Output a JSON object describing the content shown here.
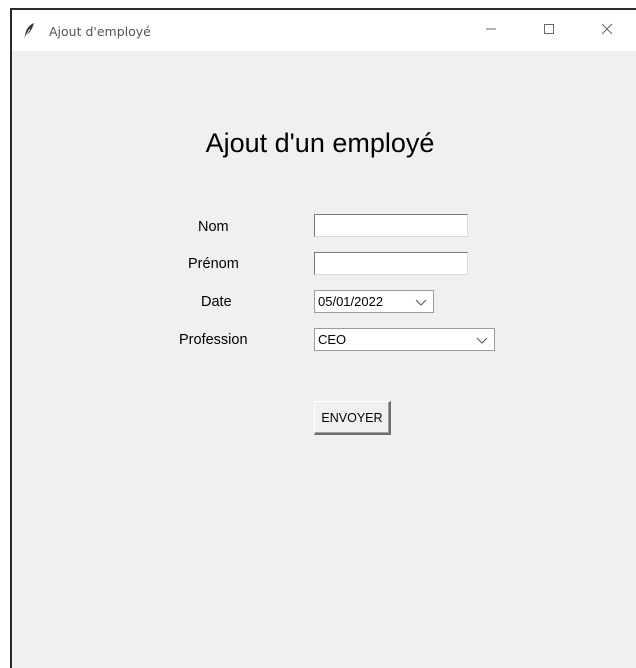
{
  "window": {
    "title": "Ajout d'employé"
  },
  "form": {
    "heading": "Ajout d'un employé",
    "nom_label": "Nom",
    "nom_value": "",
    "prenom_label": "Prénom",
    "prenom_value": "",
    "date_label": "Date",
    "date_value": "05/01/2022",
    "profession_label": "Profession",
    "profession_value": "CEO",
    "submit_label": "ENVOYER"
  },
  "icons": {
    "app": "feather-icon",
    "minimize": "minimize-icon",
    "maximize": "maximize-icon",
    "close": "close-icon",
    "dropdown": "chevron-down-icon"
  }
}
